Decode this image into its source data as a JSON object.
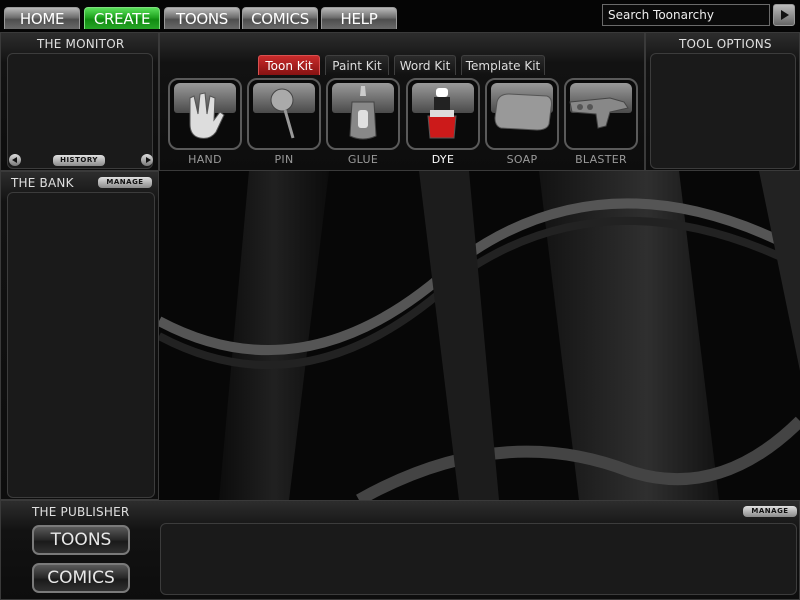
{
  "nav": {
    "tabs": [
      {
        "label": "HOME"
      },
      {
        "label": "CREATE"
      },
      {
        "label": "TOONS"
      },
      {
        "label": "COMICS"
      },
      {
        "label": "HELP"
      }
    ],
    "active_tab": "CREATE",
    "search_value": "Search Toonarchy"
  },
  "monitor": {
    "title": "THE MONITOR",
    "history_label": "HISTORY"
  },
  "toolbox": {
    "kit_tabs": [
      {
        "label": "Toon Kit"
      },
      {
        "label": "Paint Kit"
      },
      {
        "label": "Word Kit"
      },
      {
        "label": "Template Kit"
      }
    ],
    "active_kit": "Toon Kit",
    "tools": [
      {
        "label": "HAND",
        "icon": "hand-icon"
      },
      {
        "label": "PIN",
        "icon": "pin-icon"
      },
      {
        "label": "GLUE",
        "icon": "glue-icon"
      },
      {
        "label": "DYE",
        "icon": "dye-icon"
      },
      {
        "label": "SOAP",
        "icon": "soap-icon"
      },
      {
        "label": "BLASTER",
        "icon": "blaster-icon"
      }
    ],
    "active_tool": "DYE"
  },
  "tool_options": {
    "title": "TOOL OPTIONS"
  },
  "bank": {
    "title": "THE BANK",
    "manage_label": "MANAGE"
  },
  "publisher": {
    "title": "THE PUBLISHER",
    "manage_label": "MANAGE",
    "buttons": [
      {
        "label": "TOONS"
      },
      {
        "label": "COMICS"
      }
    ]
  },
  "colors": {
    "active_nav": "#1fa41f",
    "active_kit": "#a01c1c"
  }
}
